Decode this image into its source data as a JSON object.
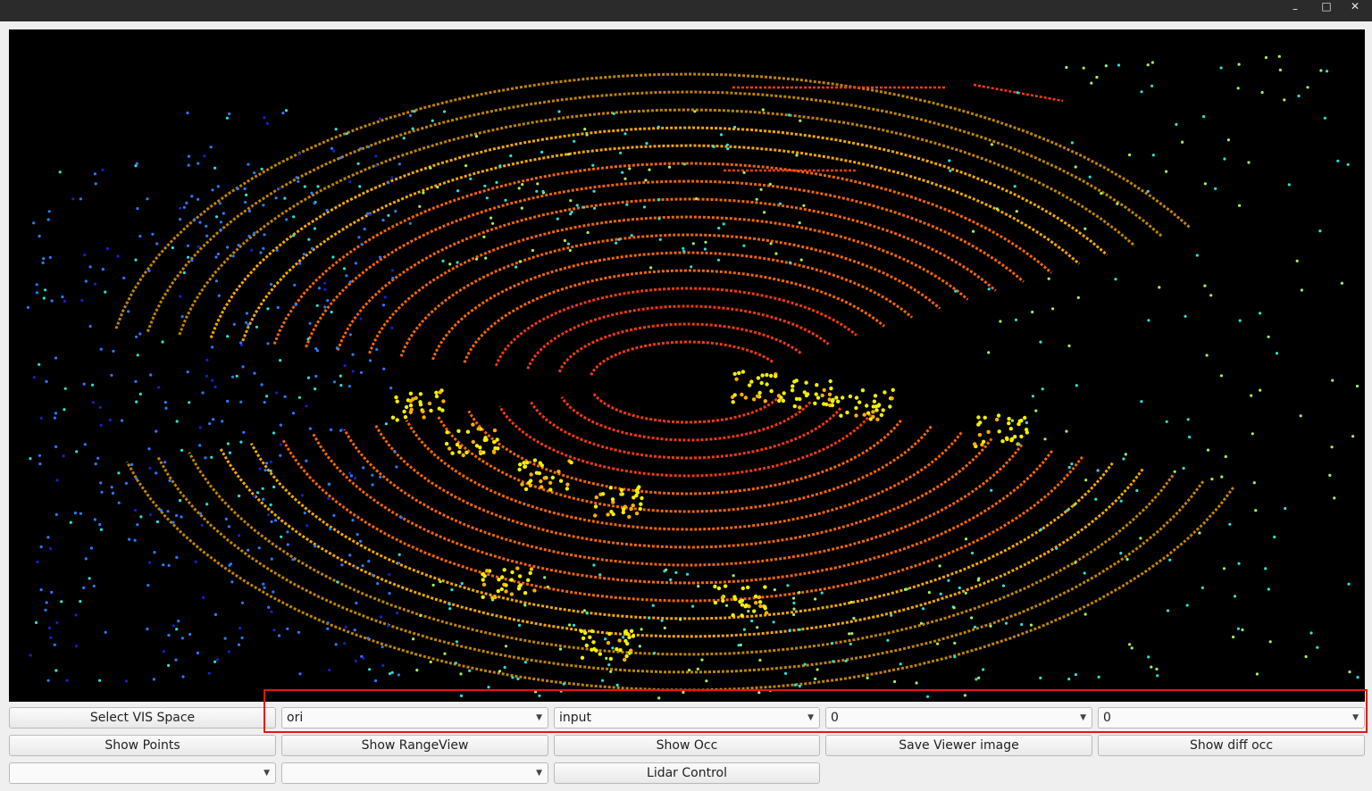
{
  "window": {
    "controls": {
      "minimize": "–",
      "maximize": "□",
      "close": "✕"
    }
  },
  "viewer": {
    "background": "#000000",
    "palette": [
      "#ff3a10",
      "#ff6a00",
      "#ffb000",
      "#f2f000",
      "#9ef25a",
      "#29e0d8",
      "#2a7aff",
      "#1222c8"
    ]
  },
  "row1": {
    "select_vis_space": "Select VIS Space",
    "combo_space": "ori",
    "combo_input": "input",
    "combo_a": "0",
    "combo_b": "0"
  },
  "row2": {
    "show_points": "Show Points",
    "show_rangeview": "Show RangeView",
    "show_occ": "Show Occ",
    "save_viewer_image": "Save Viewer image",
    "show_diff_occ": "Show diff occ"
  },
  "row3": {
    "combo_1": "",
    "combo_2": "",
    "lidar_control": "Lidar Control"
  },
  "highlight_color": "#ee1111",
  "icons": {
    "dropdown": "▼"
  }
}
